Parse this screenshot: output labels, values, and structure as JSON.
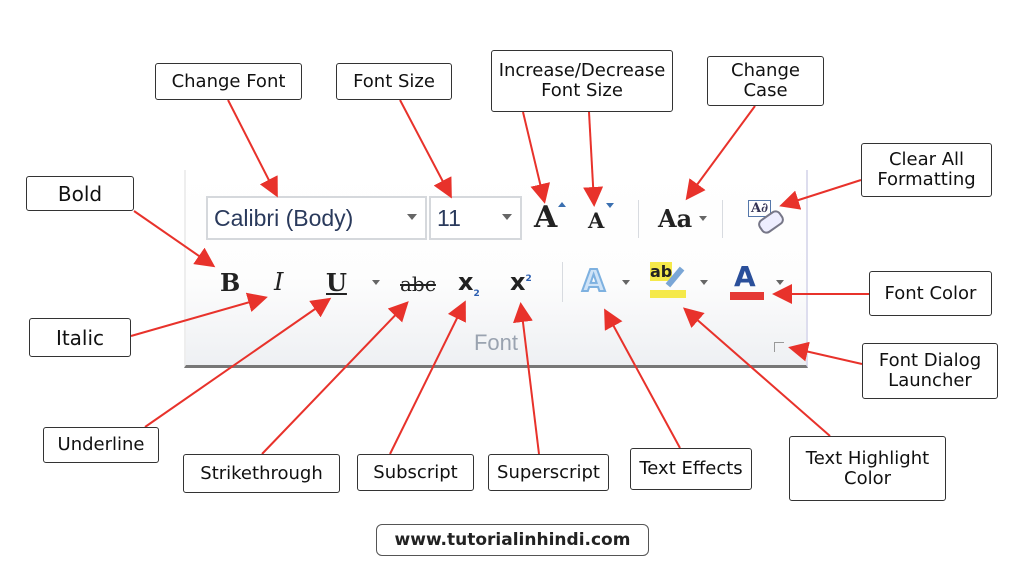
{
  "ribbon": {
    "font_name": "Calibri (Body)",
    "font_size": "11",
    "group_label": "Font",
    "icons": {
      "grow": "A",
      "shrink": "A",
      "change_case": "Aa",
      "clear": "A∂",
      "bold": "B",
      "italic": "I",
      "underline": "U",
      "strike": "abc",
      "sub": "x",
      "sub_mark": "2",
      "sup": "x",
      "sup_mark": "2",
      "effects": "A",
      "highlight": "ab",
      "font_color": "A"
    },
    "colors": {
      "highlight": "#f5e94a",
      "font_color": "#e53935",
      "arrow": "#e8322b"
    }
  },
  "callouts": {
    "change_font": "Change Font",
    "font_size": "Font Size",
    "increase_decrease": "Increase/Decrease Font Size",
    "change_case": "Change Case",
    "clear_all": "Clear All Formatting",
    "bold": "Bold",
    "italic": "Italic",
    "underline": "Underline",
    "strikethrough": "Strikethrough",
    "subscript": "Subscript",
    "superscript": "Superscript",
    "text_effects": "Text Effects",
    "text_highlight": "Text Highlight Color",
    "font_color": "Font Color",
    "font_dialog": "Font Dialog Launcher"
  },
  "footer": {
    "url": "www.tutorialinhindi.com"
  }
}
